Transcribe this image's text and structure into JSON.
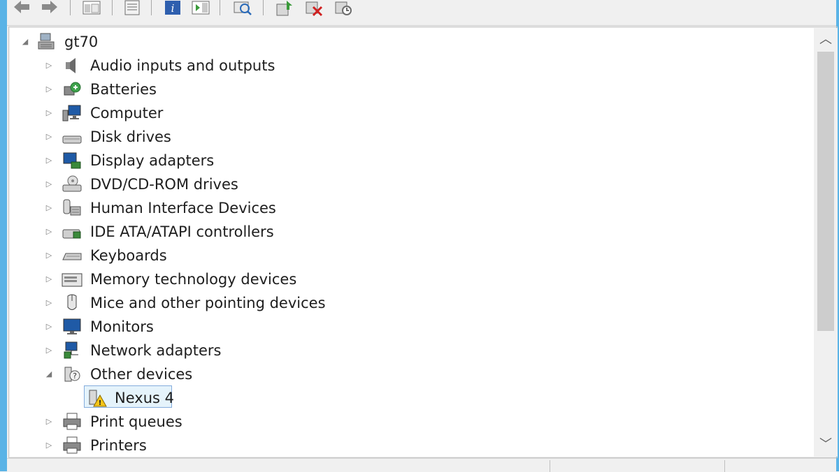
{
  "toolbar": {
    "buttons": [
      {
        "icon": "back-arrow-icon"
      },
      {
        "icon": "forward-arrow-icon"
      },
      {
        "icon": "show-hide-console-tree-icon"
      },
      {
        "icon": "properties-icon"
      },
      {
        "icon": "help-icon"
      },
      {
        "icon": "show-action-pane-icon"
      },
      {
        "icon": "scan-hardware-changes-icon"
      },
      {
        "icon": "update-driver-icon"
      },
      {
        "icon": "uninstall-device-icon"
      },
      {
        "icon": "enable-device-icon"
      }
    ]
  },
  "tree": {
    "root": {
      "label": "gt70",
      "icon": "computer-root-icon",
      "expanded": true
    },
    "categories": [
      {
        "label": "Audio inputs and outputs",
        "icon": "speaker-icon",
        "expanded": false
      },
      {
        "label": "Batteries",
        "icon": "battery-icon",
        "expanded": false
      },
      {
        "label": "Computer",
        "icon": "computer-icon",
        "expanded": false
      },
      {
        "label": "Disk drives",
        "icon": "disk-drive-icon",
        "expanded": false
      },
      {
        "label": "Display adapters",
        "icon": "display-adapter-icon",
        "expanded": false
      },
      {
        "label": "DVD/CD-ROM drives",
        "icon": "dvd-drive-icon",
        "expanded": false
      },
      {
        "label": "Human Interface Devices",
        "icon": "hid-icon",
        "expanded": false
      },
      {
        "label": "IDE ATA/ATAPI controllers",
        "icon": "ide-controller-icon",
        "expanded": false
      },
      {
        "label": "Keyboards",
        "icon": "keyboard-icon",
        "expanded": false
      },
      {
        "label": "Memory technology devices",
        "icon": "memory-device-icon",
        "expanded": false
      },
      {
        "label": "Mice and other pointing devices",
        "icon": "mouse-icon",
        "expanded": false
      },
      {
        "label": "Monitors",
        "icon": "monitor-icon",
        "expanded": false
      },
      {
        "label": "Network adapters",
        "icon": "network-adapter-icon",
        "expanded": false
      },
      {
        "label": "Other devices",
        "icon": "unknown-device-icon",
        "expanded": true
      },
      {
        "label": "Nexus 4",
        "icon": "warning-device-icon",
        "child": true,
        "selected": true
      },
      {
        "label": "Print queues",
        "icon": "print-queue-icon",
        "expanded": false
      },
      {
        "label": "Printers",
        "icon": "printer-icon",
        "expanded": false
      }
    ]
  },
  "colors": {
    "window_frame": "#5ab3e6",
    "selection_fill": "#e5f3fb",
    "selection_border": "#84acdd",
    "tree_background": "#ffffff",
    "text": "#1e1e1e",
    "expander": "#7a7a7a"
  }
}
